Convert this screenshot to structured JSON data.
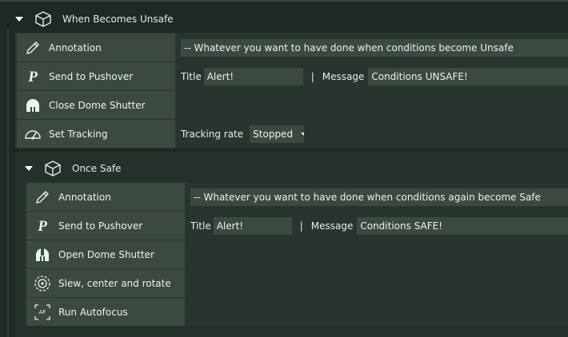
{
  "unsafe": {
    "title": "When Becomes Unsafe",
    "items": [
      {
        "label": "Annotation",
        "text": "-- Whatever you want to have done when conditions become Unsafe"
      },
      {
        "label": "Send to Pushover",
        "title_label": "Title",
        "title_value": "Alert!",
        "sep": "|",
        "message_label": "Message",
        "message_value": "Conditions UNSAFE!"
      },
      {
        "label": "Close Dome Shutter"
      },
      {
        "label": "Set Tracking",
        "rate_label": "Tracking rate",
        "rate_value": "Stopped"
      }
    ]
  },
  "safe": {
    "title": "Once Safe",
    "items": [
      {
        "label": "Annotation",
        "text": "-- Whatever you want to have done when conditions again become Safe"
      },
      {
        "label": "Send to Pushover",
        "title_label": "Title",
        "title_value": "Alert!",
        "sep": "|",
        "message_label": "Message",
        "message_value": "Conditions SAFE!"
      },
      {
        "label": "Open Dome Shutter"
      },
      {
        "label": "Slew, center and rotate"
      },
      {
        "label": "Run Autofocus",
        "icon_text": "AF"
      }
    ]
  }
}
